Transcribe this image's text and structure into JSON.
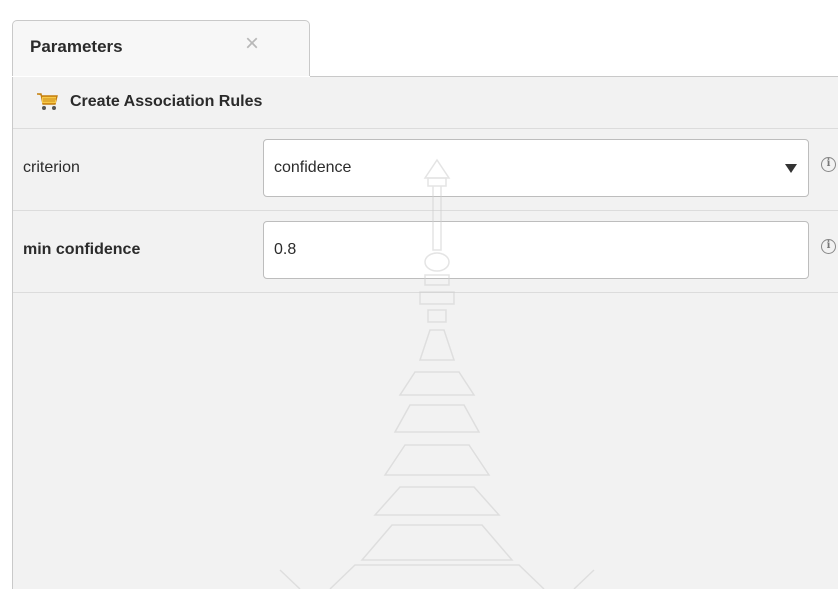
{
  "tab": {
    "title": "Parameters",
    "close_glyph": "×"
  },
  "operator": {
    "title": "Create Association Rules",
    "icon": "shopping-cart-icon"
  },
  "parameters": [
    {
      "label": "criterion",
      "value": "confidence",
      "type": "dropdown",
      "info_glyph": "i"
    },
    {
      "label": "min confidence",
      "value": "0.8",
      "type": "text",
      "info_glyph": "i"
    }
  ],
  "colors": {
    "panel_bg": "#f2f2f2",
    "tab_bg": "#f7f7f7",
    "border": "#c9c9c9",
    "cart": "#e8a317"
  }
}
